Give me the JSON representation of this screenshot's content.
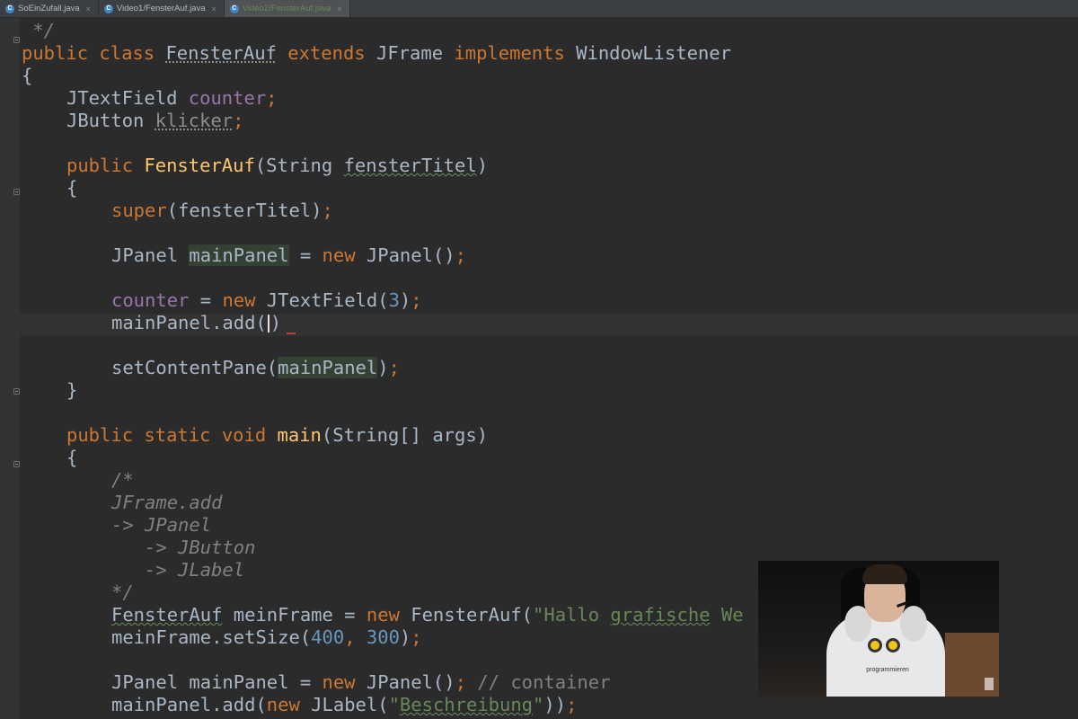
{
  "tabs": [
    {
      "name": "SoEinZufall.java",
      "icon": "C",
      "active": false
    },
    {
      "name": "Video1/FensterAuf.java",
      "icon": "C",
      "active": false
    },
    {
      "name": "Video2/FensterAuf.java",
      "icon": "C",
      "active": true
    }
  ],
  "tab_close_glyph": "×",
  "code": {
    "l1": " */",
    "l2": {
      "kw_public": "public",
      "kw_class": "class",
      "class_name": "FensterAuf",
      "kw_extends": "extends",
      "super_type": "JFrame",
      "kw_implements": "implements",
      "iface": "WindowListener"
    },
    "l3": "{",
    "l4": {
      "type": "JTextField",
      "field": "counter",
      "semi": ";"
    },
    "l5": {
      "type": "JButton",
      "field": "klicker",
      "semi": ";"
    },
    "l7": {
      "kw": "public",
      "ctor": "FensterAuf",
      "params": "(String ",
      "param": "fensterTitel",
      "close": ")"
    },
    "l8": "{",
    "l9": {
      "kw": "super",
      "rest": "(fensterTitel)",
      "semi": ";"
    },
    "l11": {
      "type": "JPanel ",
      "var": "mainPanel",
      "eq": " = ",
      "kw_new": "new",
      "rest": " JPanel()",
      "semi": ";"
    },
    "l13": {
      "field": "counter",
      "eq": " = ",
      "kw_new": "new",
      "rest": " JTextField(",
      "num": "3",
      "close": ")",
      "semi": ";"
    },
    "l14": {
      "text": "mainPanel.add(",
      "close": ")"
    },
    "l16": {
      "text": "setContentPane(",
      "arg": "mainPanel",
      "close": ")",
      "semi": ";"
    },
    "l17": "}",
    "l19": {
      "kw_public": "public",
      "kw_static": "static",
      "kw_void": "void",
      "method": "main",
      "rest": "(String[] args)"
    },
    "l20": "{",
    "l21": "/*",
    "l22": "JFrame.add",
    "l23": "-> JPanel",
    "l24": "-> JButton",
    "l25": "-> JLabel",
    "l26": "*/",
    "l27": {
      "type": "FensterAuf",
      "var": " meinFrame",
      "eq": " = ",
      "kw_new": "new",
      "rest": " FensterAuf(",
      "str_a": "\"Hallo ",
      "str_b": "grafische",
      "str_c": " We"
    },
    "l28": {
      "text": "meinFrame.setSize(",
      "n1": "400",
      "comma": ", ",
      "n2": "300",
      "close": ")",
      "semi": ";"
    },
    "l30": {
      "text": "JPanel mainPanel = ",
      "kw_new": "new",
      "rest": " JPanel()",
      "semi": ";",
      "comment": " // container"
    },
    "l31": {
      "text": "mainPanel.add(",
      "kw_new": "new",
      "rest": " JLabel(",
      "q1": "\"",
      "str": "Beschreibung",
      "q2": "\"",
      "close": "))",
      "semi": ";"
    }
  },
  "webcam": {
    "shirt_text": "programmieren"
  },
  "colors": {
    "background": "#2b2b2b",
    "keyword": "#cc7832",
    "field": "#9876aa",
    "string": "#6a8759",
    "number": "#6897bb",
    "comment": "#808080",
    "method": "#ffc66d",
    "default": "#a9b7c6"
  }
}
